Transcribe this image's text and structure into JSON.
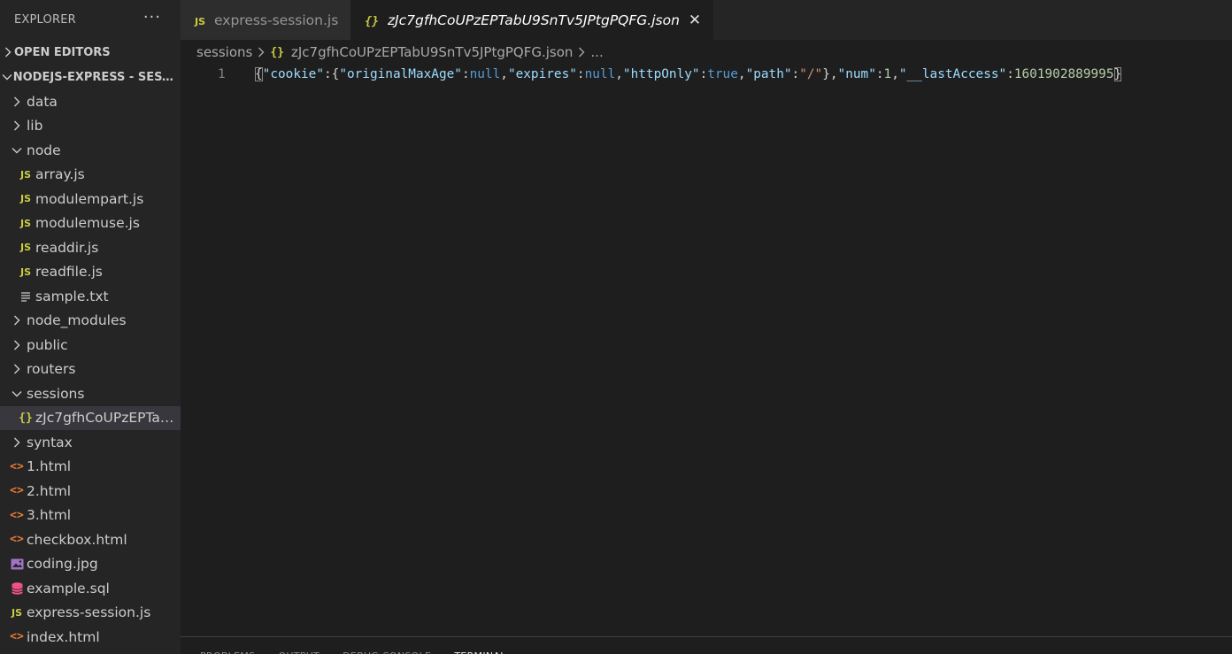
{
  "sidebar": {
    "title": "EXPLORER",
    "more": "···",
    "open_editors": "OPEN EDITORS",
    "project": "NODEJS-EXPRESS - SESSIO...",
    "items": [
      {
        "label": "data",
        "icon": "chevron-right-icon",
        "level": 0
      },
      {
        "label": "lib",
        "icon": "chevron-right-icon",
        "level": 0
      },
      {
        "label": "node",
        "icon": "chevron-down-icon",
        "level": 0
      },
      {
        "label": "array.js",
        "icon": "js-file-icon",
        "level": 1
      },
      {
        "label": "modulempart.js",
        "icon": "js-file-icon",
        "level": 1
      },
      {
        "label": "modulemuse.js",
        "icon": "js-file-icon",
        "level": 1
      },
      {
        "label": "readdir.js",
        "icon": "js-file-icon",
        "level": 1
      },
      {
        "label": "readfile.js",
        "icon": "js-file-icon",
        "level": 1
      },
      {
        "label": "sample.txt",
        "icon": "text-file-icon",
        "level": 1
      },
      {
        "label": "node_modules",
        "icon": "chevron-right-icon",
        "level": 0
      },
      {
        "label": "public",
        "icon": "chevron-right-icon",
        "level": 0
      },
      {
        "label": "routers",
        "icon": "chevron-right-icon",
        "level": 0
      },
      {
        "label": "sessions",
        "icon": "chevron-down-icon",
        "level": 0
      },
      {
        "label": "zJc7gfhCoUPzEPTab...",
        "icon": "json-file-icon",
        "level": 1,
        "selected": true
      },
      {
        "label": "syntax",
        "icon": "chevron-right-icon",
        "level": 0
      },
      {
        "label": "1.html",
        "icon": "html-file-icon",
        "level": 0
      },
      {
        "label": "2.html",
        "icon": "html-file-icon",
        "level": 0
      },
      {
        "label": "3.html",
        "icon": "html-file-icon",
        "level": 0
      },
      {
        "label": "checkbox.html",
        "icon": "html-file-icon",
        "level": 0
      },
      {
        "label": "coding.jpg",
        "icon": "image-file-icon",
        "level": 0
      },
      {
        "label": "example.sql",
        "icon": "database-file-icon",
        "level": 0
      },
      {
        "label": "express-session.js",
        "icon": "js-file-icon",
        "level": 0
      },
      {
        "label": "index.html",
        "icon": "html-file-icon",
        "level": 0
      }
    ]
  },
  "tabs": [
    {
      "label": "express-session.js",
      "icon": "js-file-icon",
      "active": false
    },
    {
      "label": "zJc7gfhCoUPzEPTabU9SnTv5JPtgPQFG.json",
      "icon": "json-file-icon",
      "active": true
    }
  ],
  "tab_close": "✕",
  "breadcrumb": {
    "folder": "sessions",
    "file": "zJc7gfhCoUPzEPTabU9SnTv5JPtgPQFG.json",
    "tail": "..."
  },
  "editor": {
    "line_number": "1",
    "tokens": [
      {
        "t": "{",
        "k": "brk"
      },
      {
        "t": "\"cookie\"",
        "k": "key"
      },
      {
        "t": ":{",
        "k": "pun"
      },
      {
        "t": "\"originalMaxAge\"",
        "k": "key"
      },
      {
        "t": ":",
        "k": "pun"
      },
      {
        "t": "null",
        "k": "kw"
      },
      {
        "t": ",",
        "k": "pun"
      },
      {
        "t": "\"expires\"",
        "k": "key"
      },
      {
        "t": ":",
        "k": "pun"
      },
      {
        "t": "null",
        "k": "kw"
      },
      {
        "t": ",",
        "k": "pun"
      },
      {
        "t": "\"httpOnly\"",
        "k": "key"
      },
      {
        "t": ":",
        "k": "pun"
      },
      {
        "t": "true",
        "k": "kw"
      },
      {
        "t": ",",
        "k": "pun"
      },
      {
        "t": "\"path\"",
        "k": "key"
      },
      {
        "t": ":",
        "k": "pun"
      },
      {
        "t": "\"/\"",
        "k": "str"
      },
      {
        "t": "},",
        "k": "pun"
      },
      {
        "t": "\"num\"",
        "k": "key"
      },
      {
        "t": ":",
        "k": "pun"
      },
      {
        "t": "1",
        "k": "num"
      },
      {
        "t": ",",
        "k": "pun"
      },
      {
        "t": "\"__lastAccess\"",
        "k": "key"
      },
      {
        "t": ":",
        "k": "pun"
      },
      {
        "t": "1601902889995",
        "k": "num"
      },
      {
        "t": "}",
        "k": "brk"
      }
    ]
  },
  "panel": {
    "tabs": [
      {
        "label": "PROBLEMS",
        "active": false
      },
      {
        "label": "OUTPUT",
        "active": false
      },
      {
        "label": "DEBUG CONSOLE",
        "active": false
      },
      {
        "label": "TERMINAL",
        "active": true
      }
    ]
  },
  "colors": {
    "sidebar_bg": "#252526",
    "editor_bg": "#1e1e1e",
    "selected_row": "#37373d",
    "js_icon": "#cbcb41",
    "html_icon": "#e37933",
    "image_icon": "#a074c4",
    "database_icon": "#f55385"
  }
}
